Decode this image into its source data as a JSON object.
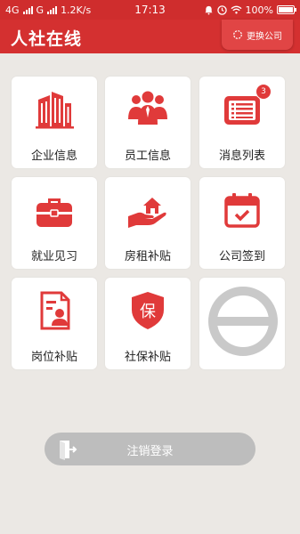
{
  "status_bar": {
    "net1": "4G",
    "net2": "G",
    "speed": "1.2K/s",
    "time": "17:13",
    "battery": "100%"
  },
  "header": {
    "title": "人社在线",
    "switch_company": "更换公司"
  },
  "grid": {
    "items": [
      {
        "label": "企业信息",
        "icon": "building-icon"
      },
      {
        "label": "员工信息",
        "icon": "people-icon"
      },
      {
        "label": "消息列表",
        "icon": "message-list-icon",
        "badge": "3"
      },
      {
        "label": "就业见习",
        "icon": "briefcase-icon"
      },
      {
        "label": "房租补贴",
        "icon": "house-hand-icon"
      },
      {
        "label": "公司签到",
        "icon": "calendar-check-icon"
      },
      {
        "label": "岗位补贴",
        "icon": "id-document-icon"
      },
      {
        "label": "社保补贴",
        "icon": "shield-bao-icon"
      }
    ],
    "placeholder_icon": "empty-slot-icon",
    "shield_char": "保"
  },
  "logout": {
    "label": "注销登录",
    "icon": "logout-door-icon"
  },
  "colors": {
    "primary": "#d43030",
    "status_bar": "#cf2d2d",
    "background": "#ebe8e4",
    "icon_red": "#e03a3a",
    "logout_bg": "#bdbdbd"
  }
}
